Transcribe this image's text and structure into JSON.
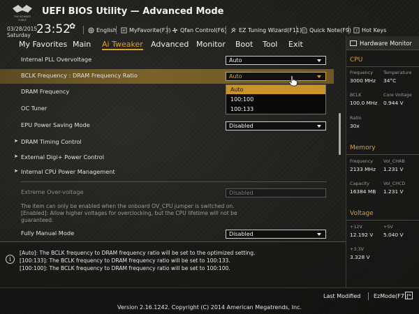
{
  "header": {
    "title": "UEFI BIOS Utility — Advanced Mode",
    "logo_text": "THE ULTIMATE FORCE",
    "date": "03/28/2015",
    "day": "Saturday",
    "time": "23:52",
    "toolbar": [
      {
        "label": "English",
        "icon": "globe-icon"
      },
      {
        "label": "MyFavorite(F3)",
        "icon": "favorite-icon"
      },
      {
        "label": "Qfan Control(F6)",
        "icon": "fan-icon"
      },
      {
        "label": "EZ Tuning Wizard(F11)",
        "icon": "wizard-icon"
      },
      {
        "label": "Quick Note(F9)",
        "icon": "note-icon"
      },
      {
        "label": "Hot Keys",
        "icon": "hotkeys-icon"
      }
    ]
  },
  "menu": {
    "tabs": [
      "My Favorites",
      "Main",
      "Ai Tweaker",
      "Advanced",
      "Monitor",
      "Boot",
      "Tool",
      "Exit"
    ],
    "active": "Ai Tweaker"
  },
  "settings": {
    "internal_pll": {
      "label": "Internal PLL Overvoltage",
      "value": "Auto"
    },
    "bclk_ratio": {
      "label": "BCLK Frequency : DRAM Frequency Ratio",
      "value": "Auto"
    },
    "dram_freq": {
      "label": "DRAM Frequency"
    },
    "oc_tuner": {
      "label": "OC Tuner"
    },
    "epu": {
      "label": "EPU Power Saving Mode",
      "value": "Disabled"
    },
    "dram_timing": {
      "label": "DRAM Timing Control"
    },
    "digi_power": {
      "label": "External Digi+ Power Control"
    },
    "cpu_power": {
      "label": "Internal CPU Power Management"
    },
    "extreme_ov": {
      "label": "Extreme Over-voltage",
      "value": "Disabled"
    },
    "note_lines": [
      "The item can only be enabled when the onboard OV_CPU jumper is switched on.",
      "[Enabled]: Allow higher voltages for overclocking, but the CPU lifetime will not be",
      "guaranteed."
    ],
    "fully_manual": {
      "label": "Fully Manual Mode",
      "value": "Disabled"
    }
  },
  "dropdown_options": [
    "Auto",
    "100:100",
    "100:133"
  ],
  "info_lines": [
    "[Auto]: The BCLK frequency to DRAM frequency ratio will be set to the optimized setting.",
    "[100:133]: The BCLK frequency to DRAM frequency ratio will be set to 100:133.",
    "[100:100]: The BCLK frequency to DRAM frequency ratio will be set to 100:100."
  ],
  "hardware_monitor": {
    "title": "Hardware Monitor",
    "cpu": {
      "section": "CPU",
      "frequency_label": "Frequency",
      "frequency": "3000 MHz",
      "temperature_label": "Temperature",
      "temperature": "34°C",
      "bclk_label": "BCLK",
      "bclk": "100.0 MHz",
      "core_voltage_label": "Core Voltage",
      "core_voltage": "0.944 V",
      "ratio_label": "Ratio",
      "ratio": "30x"
    },
    "memory": {
      "section": "Memory",
      "frequency_label": "Frequency",
      "frequency": "2133 MHz",
      "vol_chab_label": "Vol_CHAB",
      "vol_chab": "1.231 V",
      "capacity_label": "Capacity",
      "capacity": "16384 MB",
      "vol_chcd_label": "Vol_CHCD",
      "vol_chcd": "1.231 V"
    },
    "voltage": {
      "section": "Voltage",
      "v12_label": "+12V",
      "v12": "12.192 V",
      "v5_label": "+5V",
      "v5": "5.040 V",
      "v33_label": "+3.3V",
      "v33": "3.328 V"
    }
  },
  "footer": {
    "last_modified": "Last Modified",
    "ezmode": "EzMode(F7)|",
    "copyright": "Version 2.16.1242. Copyright (C) 2014 American Megatrends, Inc."
  },
  "colors": {
    "accent": "#d9a22e",
    "highlight": "#6d5825"
  }
}
